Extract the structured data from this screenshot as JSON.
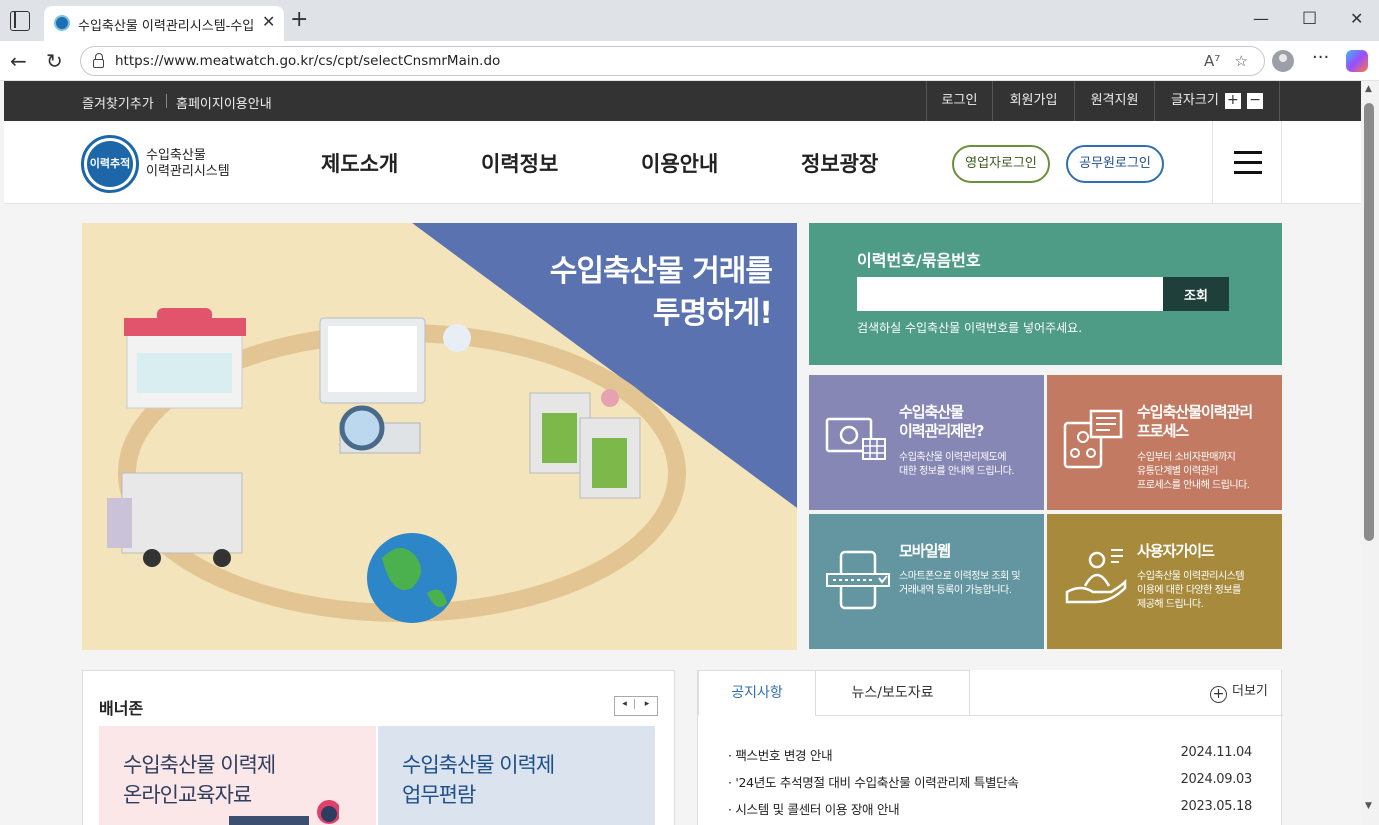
{
  "browser": {
    "tab_title": "수입축산물 이력관리시스템-수입",
    "url": "https://www.meatwatch.go.kr/cs/cpt/selectCnsmrMain.do"
  },
  "topnav": {
    "left": [
      "즐겨찾기추가",
      "홈페이지이용안내"
    ],
    "right": [
      "로그인",
      "회원가입",
      "원격지원"
    ],
    "font_size_label": "글자크기",
    "font_plus": "+",
    "font_minus": "−"
  },
  "header": {
    "logo_badge": "이력추적",
    "logo_line1": "수입축산물",
    "logo_line2": "이력관리시스템",
    "menu": [
      "제도소개",
      "이력정보",
      "이용안내",
      "정보광장"
    ],
    "btn_business": "영업자로그인",
    "btn_official": "공무원로그인"
  },
  "hero": {
    "title_line1": "수입축산물 거래를",
    "title_line2": "투명하게!"
  },
  "search": {
    "label": "이력번호/묶음번호",
    "value": "",
    "button": "조회",
    "help": "검색하실 수입축산물 이력번호를 넣어주세요."
  },
  "tiles": [
    {
      "title1": "수입축산물",
      "title2": "이력관리제란?",
      "desc1": "수입축산물 이력관리제도에",
      "desc2": "대한 정보를 안내해 드립니다.",
      "desc3": "",
      "color": "#8687b5"
    },
    {
      "title1": "수입축산물이력관리",
      "title2": "프로세스",
      "desc1": "수입부터 소비자판매까지",
      "desc2": "유통단계별 이력관리",
      "desc3": "프로세스를 안내해 드립니다.",
      "color": "#c27a62"
    },
    {
      "title1": "모바일웹",
      "title2": "",
      "desc1": "스마트폰으로 이력정보 조회 및",
      "desc2": "거래내역 등록이 가능합니다.",
      "desc3": "",
      "color": "#6396a0"
    },
    {
      "title1": "사용자가이드",
      "title2": "",
      "desc1": "수입축산물 이력관리시스템",
      "desc2": "이용에 대한 다양한 정보를",
      "desc3": "제공해 드립니다.",
      "color": "#a78a3c"
    }
  ],
  "banner": {
    "title": "배너존",
    "prev": "◂",
    "next": "▸",
    "item1_line1": "수입축산물 이력제",
    "item1_line2": "온라인교육자료",
    "item2_line1": "수입축산물 이력제",
    "item2_line2": "업무편람"
  },
  "notices": {
    "tab_active": "공지사항",
    "tab_other": "뉴스/보도자료",
    "more": "더보기",
    "rows": [
      {
        "title": "팩스번호 변경 안내",
        "date": "2024.11.04"
      },
      {
        "title": "'24년도 추석명절 대비 수입축산물 이력관리제 특별단속",
        "date": "2024.09.03"
      },
      {
        "title": "시스템 및 콜센터 이용 장애 안내",
        "date": "2023.05.18"
      }
    ]
  }
}
